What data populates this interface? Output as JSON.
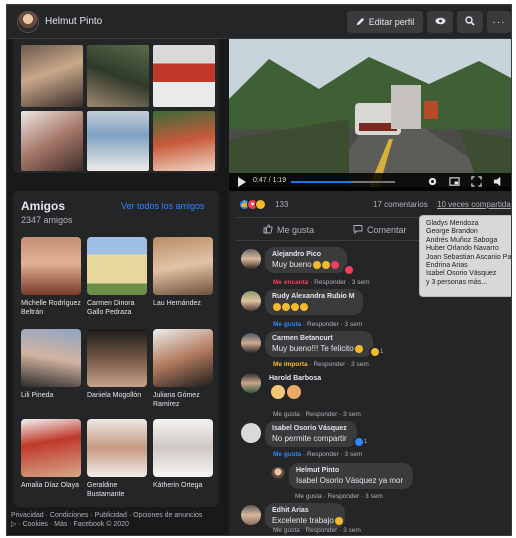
{
  "header": {
    "profile_name": "Helmut Pinto",
    "edit_profile": "Editar perfil",
    "more": "···"
  },
  "video": {
    "time": "0:47 / 1:19",
    "progress": 0.59
  },
  "friends": {
    "title": "Amigos",
    "count": "2347 amigos",
    "see_all": "Ver todos los amigos",
    "items": [
      {
        "name": "Michelle Rodríguez Beltrán"
      },
      {
        "name": "Carmen Dinora Gallo Pedraza"
      },
      {
        "name": "Lau Hernández"
      },
      {
        "name": "Lili Pineda"
      },
      {
        "name": "Daniela Mogollón"
      },
      {
        "name": "Juliana Gómez Ramírez"
      },
      {
        "name": "Amalia Díaz Olaya"
      },
      {
        "name": "Geraldine Bustamante"
      },
      {
        "name": "Kátherin Ortega"
      }
    ]
  },
  "footer": {
    "line1": "Privacidad · Condiciones · Publicidad · Opciones de anuncios",
    "line2": "▷ · Cookies · Más · Facebook © 2020"
  },
  "post": {
    "reaction_count": "133",
    "comments_count": "17 comentarios",
    "shares_count": "10 veces compartida",
    "like": "Me gusta",
    "comment": "Comentar"
  },
  "tooltip": {
    "names": [
      "Gladys Mendoza",
      "George Brandon",
      "Andrés Muñoz Saboga",
      "Huber Orlando Navarro",
      "Joan Sebastian Ascanio Paba",
      "Endrina Arias",
      "Isabel Osorio Vásquez",
      "y 3 personas más..."
    ]
  },
  "comments": [
    {
      "name": "Alejandro Pico",
      "text": "Muy bueno",
      "react": "Me encanta",
      "reply": "Responder",
      "time": "3 sem",
      "badge_count": ""
    },
    {
      "name": "Rudy Alexandra Rubio M",
      "text": "",
      "react": "Me gusta",
      "reply": "Responder",
      "time": "3 sem",
      "badge_count": ""
    },
    {
      "name": "Carmen Betancurt",
      "text": "Muy bueno!!! Te felicito",
      "react": "Me importa",
      "reply": "Responder",
      "time": "3 sem",
      "badge_count": "1"
    },
    {
      "name": "Harold Barbosa",
      "text": "",
      "react": "Me gusta",
      "reply": "Responder",
      "time": "3 sem",
      "badge_count": ""
    },
    {
      "name": "Isabel Osorio Vásquez",
      "text": "No permite compartir",
      "react": "Me gusta",
      "reply": "Responder",
      "time": "3 sem",
      "badge_count": "1"
    },
    {
      "name": "Helmut Pinto",
      "text": "Isabel Osorio Vásquez ya mor",
      "react": "Me gusta",
      "reply": "Responder",
      "time": "3 sem",
      "badge_count": ""
    },
    {
      "name": "Edhit Arias",
      "text": "Excelente trabajo",
      "react": "Me gusta",
      "reply": "Responder",
      "time": "3 sem",
      "badge_count": ""
    }
  ],
  "colors": {
    "accent": "#2d88ff",
    "love": "#f33e58",
    "care": "#f7b928",
    "panel": "#242526",
    "bg": "#18191a"
  }
}
